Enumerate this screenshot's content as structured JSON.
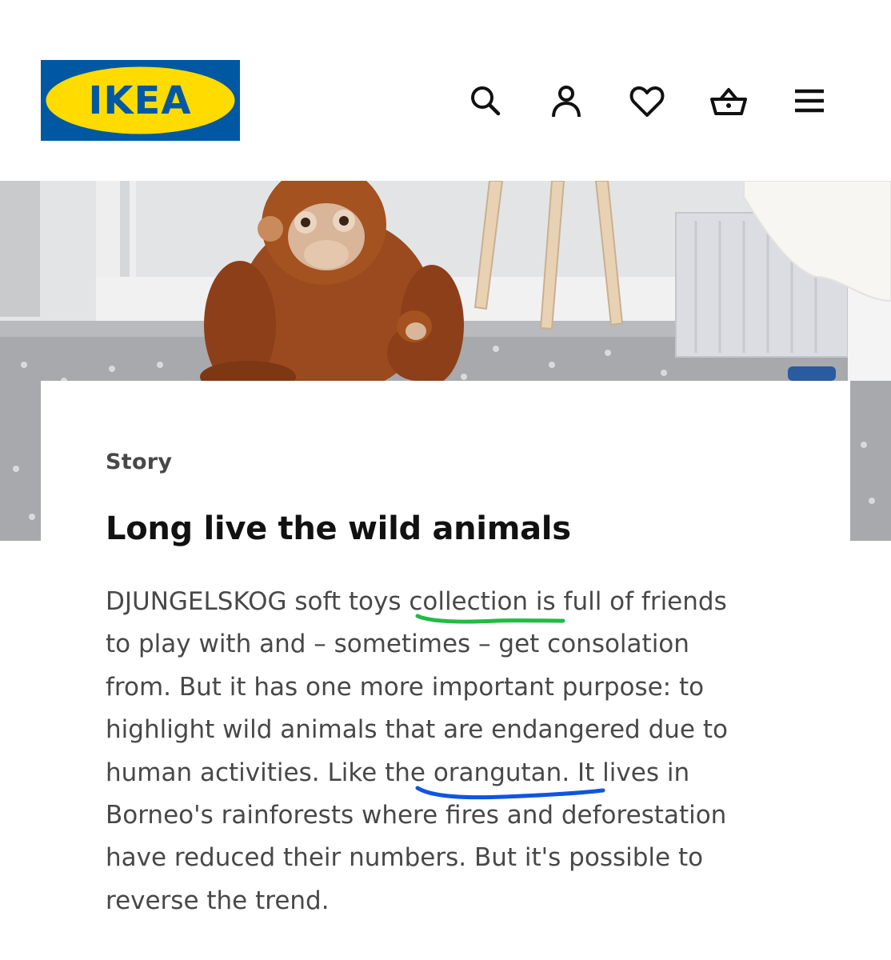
{
  "header": {
    "logo_text": "IKEA",
    "logo_colors": {
      "background": "#0058a3",
      "oval": "#ffdb00",
      "text": "#0058a3"
    },
    "icons": [
      "search-icon",
      "account-icon",
      "heart-icon",
      "basket-icon",
      "menu-icon"
    ]
  },
  "hero": {
    "image_subject": "orangutan-soft-toy"
  },
  "article": {
    "eyebrow": "Story",
    "title": "Long live the wild animals",
    "body_lines": [
      "DJUNGELSKOG soft toys collection is full of friends",
      "to play with and – sometimes – get consolation",
      "from. But it has one more important purpose: to",
      "highlight wild animals that are endangered due to",
      "human activities. Like the orangutan. It lives in",
      "Borneo's rainforests where fires and deforestation",
      "have reduced their numbers. But it's possible to",
      "reverse the trend."
    ]
  },
  "annotations": {
    "green_underline_color": "#22bb44",
    "blue_underline_color": "#1155dd"
  }
}
